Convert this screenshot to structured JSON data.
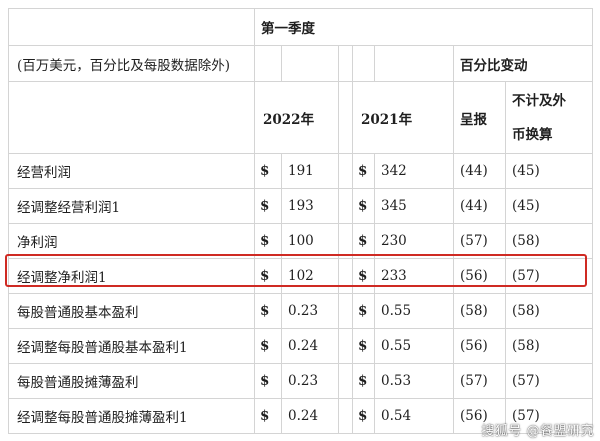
{
  "header": {
    "period": "第一季度",
    "unit_note": "(百万美元，百分比及每股数据除外)",
    "pct_change": "百分比变动",
    "year_2022": "2022年",
    "year_2021": "2021年",
    "reported": "呈报",
    "ex_fx_line1": "不计及外",
    "ex_fx_line2": "币换算"
  },
  "currency": "$",
  "rows": [
    {
      "label": "经营利润",
      "v2022": "191",
      "v2021": "342",
      "reported": "(44)",
      "ex_fx": "(45)"
    },
    {
      "label": "经调整经营利润1",
      "v2022": "193",
      "v2021": "345",
      "reported": "(44)",
      "ex_fx": "(45)"
    },
    {
      "label": "净利润",
      "v2022": "100",
      "v2021": "230",
      "reported": "(57)",
      "ex_fx": "(58)"
    },
    {
      "label": "经调整净利润1",
      "v2022": "102",
      "v2021": "233",
      "reported": "(56)",
      "ex_fx": "(57)"
    },
    {
      "label": "每股普通股基本盈利",
      "v2022": "0.23",
      "v2021": "0.55",
      "reported": "(58)",
      "ex_fx": "(58)"
    },
    {
      "label": "经调整每股普通股基本盈利1",
      "v2022": "0.24",
      "v2021": "0.55",
      "reported": "(56)",
      "ex_fx": "(58)"
    },
    {
      "label": "每股普通股摊薄盈利",
      "v2022": "0.23",
      "v2021": "0.53",
      "reported": "(57)",
      "ex_fx": "(57)"
    },
    {
      "label": "经调整每股普通股摊薄盈利1",
      "v2022": "0.24",
      "v2021": "0.54",
      "reported": "(56)",
      "ex_fx": "(57)"
    }
  ],
  "watermark": "搜狐号 @餐盟研究"
}
